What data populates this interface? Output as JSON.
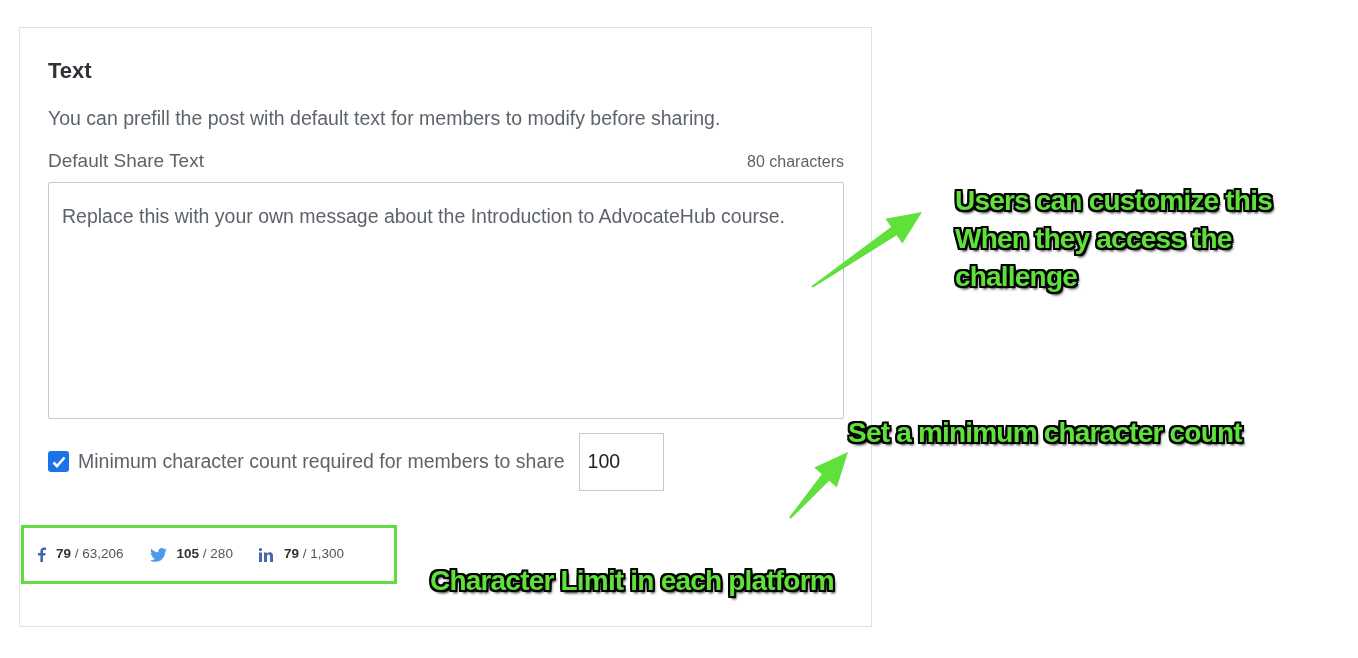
{
  "section": {
    "title": "Text",
    "description": "You can prefill the post with default text for members to modify before sharing.",
    "field_label": "Default Share Text",
    "char_count": "80 characters",
    "share_text": "Replace this with your own message about the Introduction to AdvocateHub course.",
    "minimum": {
      "checked": true,
      "label": "Minimum character count required for members to share",
      "value": "100"
    },
    "platforms": [
      {
        "kind": "facebook",
        "count": "**79** / 63,206"
      },
      {
        "kind": "twitter",
        "count": "**105** / 280"
      },
      {
        "kind": "linkedin",
        "count": "**79** / 1,300"
      }
    ]
  },
  "annotations": [
    {
      "kind": "customize",
      "text": "Users can customize this When they access the challenge"
    },
    {
      "kind": "minimum",
      "text": "Set a minimum character count"
    },
    {
      "kind": "platforms",
      "text": "Character Limit in each platform"
    }
  ]
}
